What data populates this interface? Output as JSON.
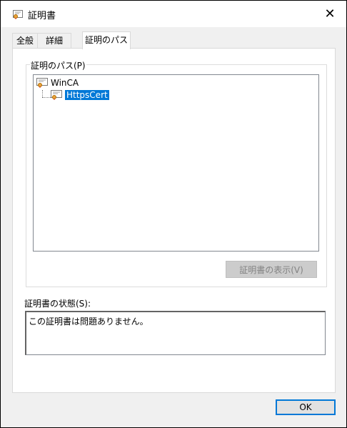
{
  "window": {
    "title": "証明書"
  },
  "tabs": [
    {
      "label": "全般"
    },
    {
      "label": "詳細"
    },
    {
      "label": "証明のパス"
    }
  ],
  "path_group": {
    "label": "証明のパス(P)",
    "tree": [
      {
        "label": "WinCA"
      },
      {
        "label": "HttpsCert"
      }
    ],
    "view_button": "証明書の表示(V)"
  },
  "status": {
    "label": "証明書の状態(S):",
    "text": "この証明書は問題ありません。"
  },
  "ok_button": "OK",
  "colors": {
    "selection": "#0078d7",
    "focus_border": "#0078d7"
  }
}
